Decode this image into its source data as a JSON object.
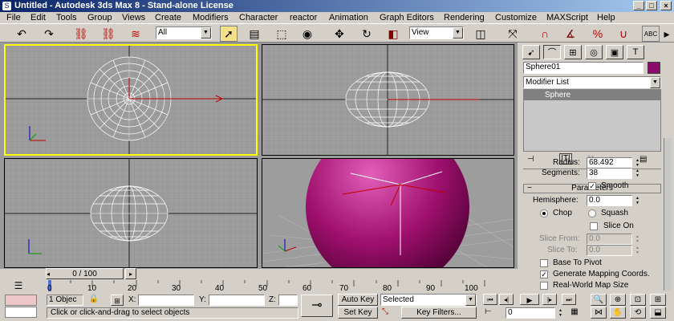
{
  "window": {
    "title": "Untitled - Autodesk 3ds Max 8 - Stand-alone License",
    "app_icon_letter": "S"
  },
  "menu": [
    "File",
    "Edit",
    "Tools",
    "Group",
    "Views",
    "Create",
    "Modifiers",
    "Character",
    "reactor",
    "Animation",
    "Graph Editors",
    "Rendering",
    "Customize",
    "MAXScript",
    "Help"
  ],
  "toolbar": {
    "selection_filter": "All",
    "reference_coord": "View",
    "icons": [
      "undo-icon",
      "redo-icon",
      "link-icon",
      "unlink-icon",
      "bind-space-warp-icon",
      "select-object-icon",
      "select-by-name-icon",
      "rectangular-selection-icon",
      "window-crossing-icon",
      "select-move-icon",
      "select-rotate-icon",
      "select-scale-icon",
      "pivot-icon",
      "select-manipulate-icon",
      "snaps-toggle-icon",
      "angle-snap-icon",
      "percent-snap-icon",
      "spinner-snap-icon",
      "mirror-icon",
      "align-icon"
    ],
    "spelling_badge": "ABC"
  },
  "command_panel": {
    "object_name": "Sphere01",
    "object_color": "#8b0a6c",
    "modifier_list": "Modifier List",
    "stack_item": "Sphere",
    "rollout_title": "Parameters",
    "radius_label": "Radius:",
    "radius_value": "68.492",
    "segments_label": "Segments:",
    "segments_value": "38",
    "smooth_label": "Smooth",
    "smooth_checked": true,
    "hemisphere_label": "Hemisphere:",
    "hemisphere_value": "0.0",
    "chop_label": "Chop",
    "squash_label": "Squash",
    "slice_on_label": "Slice On",
    "slice_from_label": "Slice From:",
    "slice_from_value": "0.0",
    "slice_to_label": "Slice To:",
    "slice_to_value": "0.0",
    "base_to_pivot_label": "Base To Pivot",
    "gen_mapping_label": "Generate Mapping Coords.",
    "gen_mapping_checked": true,
    "real_world_label": "Real-World Map Size"
  },
  "timeline": {
    "slider_text": "0 / 100",
    "ticks": [
      "0",
      "10",
      "20",
      "30",
      "40",
      "50",
      "60",
      "70",
      "80",
      "90",
      "100"
    ]
  },
  "status": {
    "selection_count": "1 Objec",
    "x_label": "X:",
    "y_label": "Y:",
    "z_label": "Z:",
    "prompt": "Click or click-and-drag to select objects",
    "auto_key": "Auto Key",
    "set_key": "Set Key",
    "selected_combo": "Selected",
    "key_filters": "Key Filters...",
    "frame_value": "0"
  },
  "colors": {
    "active_viewport_border": "#ffff00",
    "sphere_color": "#a0106f"
  }
}
